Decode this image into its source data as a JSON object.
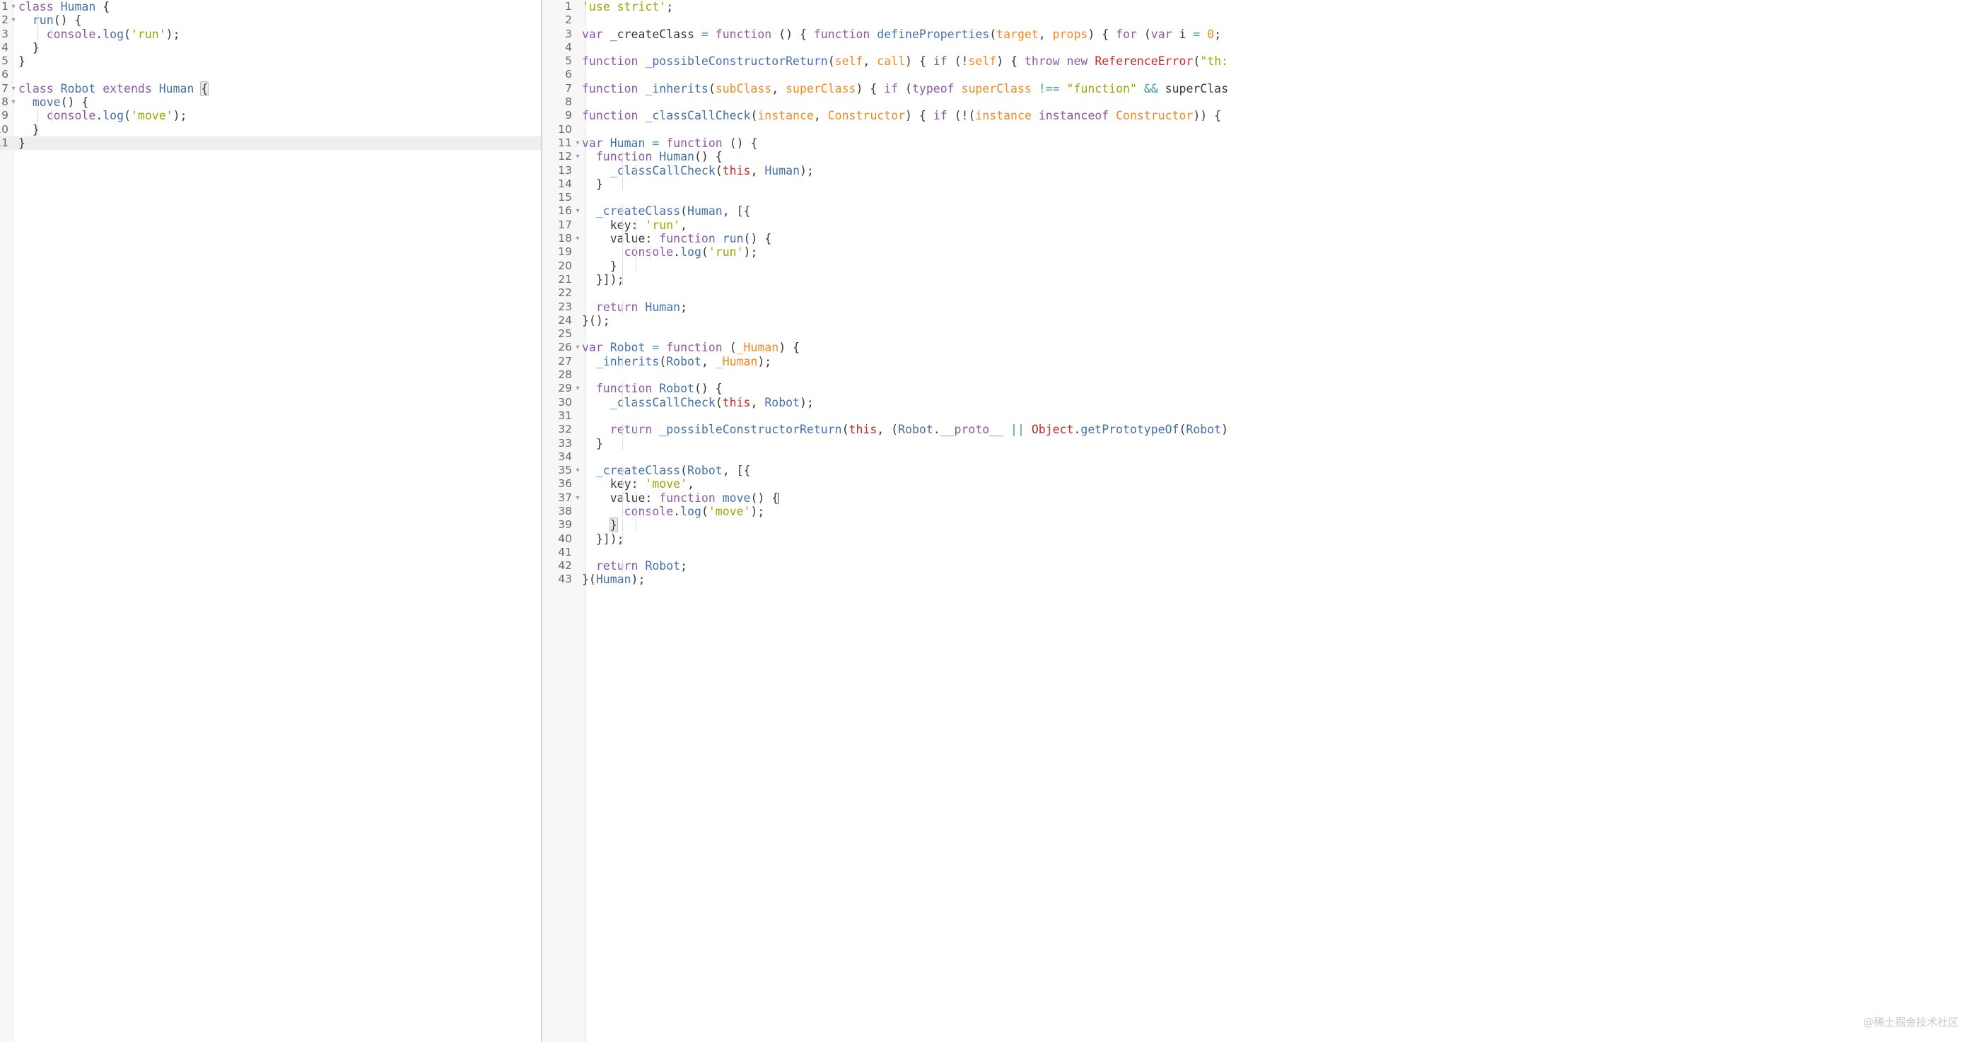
{
  "window": {
    "title": "ES6 class to ES5 transpile comparison",
    "background": "#ffffff",
    "gutter_background": "#f7f7f7",
    "active_line_background": "#eeeeee"
  },
  "theme": {
    "name": "tomorrow-light",
    "foreground": "#383838",
    "keyword": "#8959a8",
    "string": "#9aa700",
    "function": "#4271ae",
    "parameter": "#f5871f",
    "this_keyword": "#c82829",
    "operator": "#3e999f",
    "number": "#f5871f",
    "line_number": "#6a6a6a",
    "indent_guide": "#dcdcdc",
    "bracket_match_outline": "#bbbbbb"
  },
  "watermark": {
    "text": "@稀土掘金技术社区"
  },
  "left_editor": {
    "name": "source-es6",
    "language": "JavaScript (ES6)",
    "first_visible_line": 1,
    "active_line": 11,
    "lines": [
      {
        "n": 1,
        "fold": "▾",
        "text": "class Human {"
      },
      {
        "n": 2,
        "fold": "▾",
        "text": "  run() {"
      },
      {
        "n": 3,
        "fold": "",
        "text": "    console.log('run');"
      },
      {
        "n": 4,
        "fold": "",
        "text": "  }"
      },
      {
        "n": 5,
        "fold": "",
        "text": "}"
      },
      {
        "n": 6,
        "fold": "",
        "text": ""
      },
      {
        "n": 7,
        "fold": "▾",
        "text": "class Robot extends Human {"
      },
      {
        "n": 8,
        "fold": "▾",
        "text": "  move() {"
      },
      {
        "n": 9,
        "fold": "",
        "text": "    console.log('move');"
      },
      {
        "n": 10,
        "fold": "",
        "text": "  }"
      },
      {
        "n": 11,
        "fold": "",
        "text": "}"
      }
    ]
  },
  "right_editor": {
    "name": "output-es5",
    "language": "JavaScript (ES5)",
    "first_visible_line": 1,
    "cursor_line": 37,
    "lines": [
      {
        "n": 1,
        "fold": "",
        "text": "'use strict';"
      },
      {
        "n": 2,
        "fold": "",
        "text": ""
      },
      {
        "n": 3,
        "fold": "",
        "text": "var _createClass = function () { function defineProperties(target, props) { for (var i = 0;"
      },
      {
        "n": 4,
        "fold": "",
        "text": ""
      },
      {
        "n": 5,
        "fold": "",
        "text": "function _possibleConstructorReturn(self, call) { if (!self) { throw new ReferenceError(\"th:"
      },
      {
        "n": 6,
        "fold": "",
        "text": ""
      },
      {
        "n": 7,
        "fold": "",
        "text": "function _inherits(subClass, superClass) { if (typeof superClass !== \"function\" && superClas"
      },
      {
        "n": 8,
        "fold": "",
        "text": ""
      },
      {
        "n": 9,
        "fold": "",
        "text": "function _classCallCheck(instance, Constructor) { if (!(instance instanceof Constructor)) {"
      },
      {
        "n": 10,
        "fold": "",
        "text": ""
      },
      {
        "n": 11,
        "fold": "▾",
        "text": "var Human = function () {"
      },
      {
        "n": 12,
        "fold": "▾",
        "text": "  function Human() {"
      },
      {
        "n": 13,
        "fold": "",
        "text": "    _classCallCheck(this, Human);"
      },
      {
        "n": 14,
        "fold": "",
        "text": "  }"
      },
      {
        "n": 15,
        "fold": "",
        "text": ""
      },
      {
        "n": 16,
        "fold": "▾",
        "text": "  _createClass(Human, [{"
      },
      {
        "n": 17,
        "fold": "",
        "text": "    key: 'run',"
      },
      {
        "n": 18,
        "fold": "▾",
        "text": "    value: function run() {"
      },
      {
        "n": 19,
        "fold": "",
        "text": "      console.log('run');"
      },
      {
        "n": 20,
        "fold": "",
        "text": "    }"
      },
      {
        "n": 21,
        "fold": "",
        "text": "  }]);"
      },
      {
        "n": 22,
        "fold": "",
        "text": ""
      },
      {
        "n": 23,
        "fold": "",
        "text": "  return Human;"
      },
      {
        "n": 24,
        "fold": "",
        "text": "}();"
      },
      {
        "n": 25,
        "fold": "",
        "text": ""
      },
      {
        "n": 26,
        "fold": "▾",
        "text": "var Robot = function (_Human) {"
      },
      {
        "n": 27,
        "fold": "",
        "text": "  _inherits(Robot, _Human);"
      },
      {
        "n": 28,
        "fold": "",
        "text": ""
      },
      {
        "n": 29,
        "fold": "▾",
        "text": "  function Robot() {"
      },
      {
        "n": 30,
        "fold": "",
        "text": "    _classCallCheck(this, Robot);"
      },
      {
        "n": 31,
        "fold": "",
        "text": ""
      },
      {
        "n": 32,
        "fold": "",
        "text": "    return _possibleConstructorReturn(this, (Robot.__proto__ || Object.getPrototypeOf(Robot)"
      },
      {
        "n": 33,
        "fold": "",
        "text": "  }"
      },
      {
        "n": 34,
        "fold": "",
        "text": ""
      },
      {
        "n": 35,
        "fold": "▾",
        "text": "  _createClass(Robot, [{"
      },
      {
        "n": 36,
        "fold": "",
        "text": "    key: 'move',"
      },
      {
        "n": 37,
        "fold": "▾",
        "text": "    value: function move() {"
      },
      {
        "n": 38,
        "fold": "",
        "text": "      console.log('move');"
      },
      {
        "n": 39,
        "fold": "",
        "text": "    }"
      },
      {
        "n": 40,
        "fold": "",
        "text": "  }]);"
      },
      {
        "n": 41,
        "fold": "",
        "text": ""
      },
      {
        "n": 42,
        "fold": "",
        "text": "  return Robot;"
      },
      {
        "n": 43,
        "fold": "",
        "text": "}(Human);"
      }
    ]
  }
}
